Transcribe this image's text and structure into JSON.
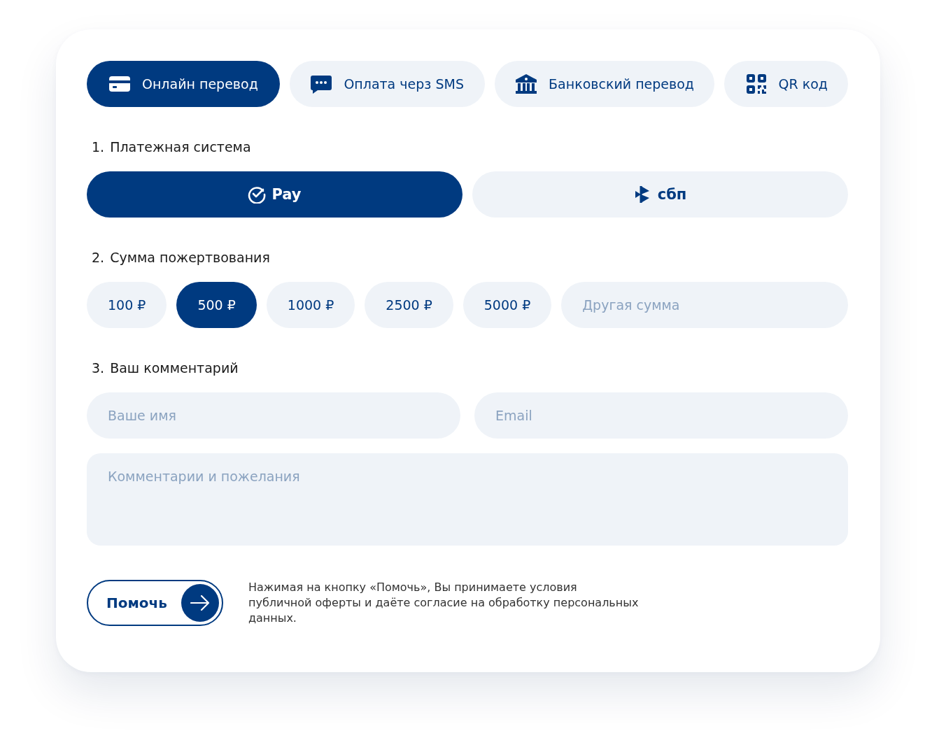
{
  "tabs": [
    {
      "label": "Онлайн перевод",
      "kind": "card",
      "selected": true
    },
    {
      "label": "Оплата черз SMS",
      "kind": "chat",
      "selected": false
    },
    {
      "label": "Банковский перевод",
      "kind": "bank",
      "selected": false
    },
    {
      "label": "QR код",
      "kind": "qr",
      "selected": false
    }
  ],
  "sections": [
    {
      "number": "1.",
      "title": "Платежная система"
    },
    {
      "number": "2.",
      "title": "Сумма пожертвования"
    },
    {
      "number": "3.",
      "title": "Ваш комментарий"
    }
  ],
  "payment_systems": [
    {
      "label": "Pay",
      "kind": "check",
      "selected": true
    },
    {
      "label": "сбп",
      "kind": "sbp",
      "selected": false
    }
  ],
  "amounts": [
    {
      "label": "100 ₽",
      "selected": false
    },
    {
      "label": "500 ₽",
      "selected": true
    },
    {
      "label": "1000 ₽",
      "selected": false
    },
    {
      "label": "2500 ₽",
      "selected": false
    },
    {
      "label": "5000 ₽",
      "selected": false
    }
  ],
  "other_amount": {
    "placeholder": "Другая сумма"
  },
  "name_field": {
    "placeholder": "Ваше имя"
  },
  "email_field": {
    "placeholder": "Email"
  },
  "comment_field": {
    "placeholder": "Комментарии и пожелания"
  },
  "submit": {
    "label": "Помочь"
  },
  "disclaimer": "Нажимая на кнопку «Помочь», Вы принимаете условия публичной оферты и даёте согласие на обработку персональных данных."
}
